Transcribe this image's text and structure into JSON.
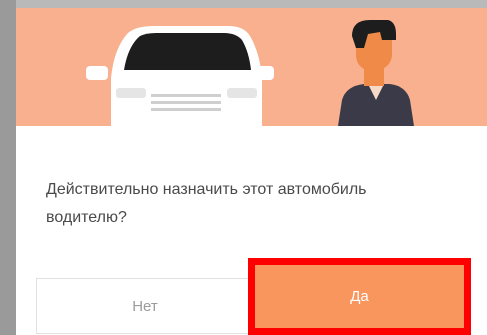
{
  "dialog": {
    "message": "Действительно назначить этот автомобиль водителю?",
    "no_label": "Нет",
    "yes_label": "Да",
    "hero_icons": [
      "car-illustration",
      "driver-illustration"
    ]
  },
  "colors": {
    "hero_background": "#f8b08f",
    "primary_button": "#f8965e",
    "highlight_frame": "#ff0000",
    "text": "#4a4a4a"
  }
}
